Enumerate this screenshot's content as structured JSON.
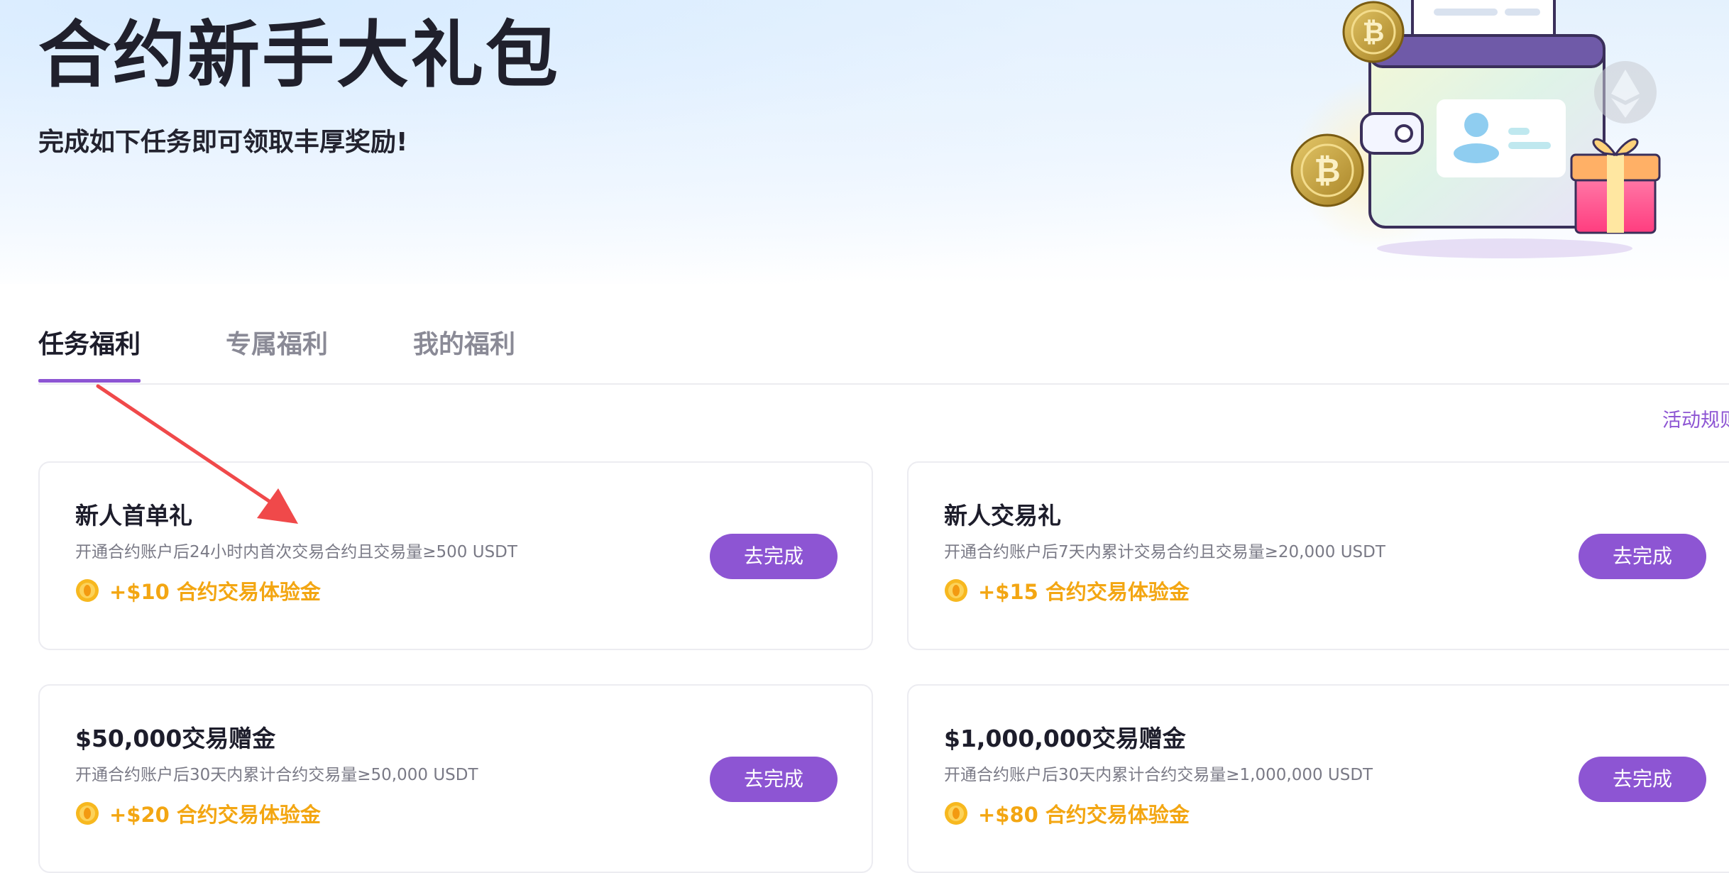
{
  "hero": {
    "title": "合约新手大礼包",
    "subtitle": "完成如下任务即可领取丰厚奖励!"
  },
  "tabs": [
    {
      "label": "任务福利",
      "active": true
    },
    {
      "label": "专属福利",
      "active": false
    },
    {
      "label": "我的福利",
      "active": false
    }
  ],
  "rules_link": "活动规则",
  "tasks": [
    {
      "title": "新人首单礼",
      "description": "开通合约账户后24小时内首次交易合约且交易量≥500 USDT",
      "reward": "+$10 合约交易体验金",
      "button": "去完成"
    },
    {
      "title": "新人交易礼",
      "description": "开通合约账户后7天内累计交易合约且交易量≥20,000 USDT",
      "reward": "+$15 合约交易体验金",
      "button": "去完成"
    },
    {
      "title": "$50,000交易赠金",
      "description": "开通合约账户后30天内累计合约交易量≥50,000 USDT",
      "reward": "+$20 合约交易体验金",
      "button": "去完成"
    },
    {
      "title": "$1,000,000交易赠金",
      "description": "开通合约账户后30天内累计合约交易量≥1,000,000 USDT",
      "reward": "+$80 合约交易体验金",
      "button": "去完成"
    }
  ],
  "colors": {
    "accent": "#8d55d3",
    "reward": "#f3a612",
    "annotation_arrow": "#f0494a"
  },
  "icons": {
    "coin": "coin-icon",
    "bitcoin": "bitcoin-coin-icon",
    "ethereum": "ethereum-coin-icon",
    "wallet": "wallet-illustration",
    "gift": "gift-box-icon"
  }
}
